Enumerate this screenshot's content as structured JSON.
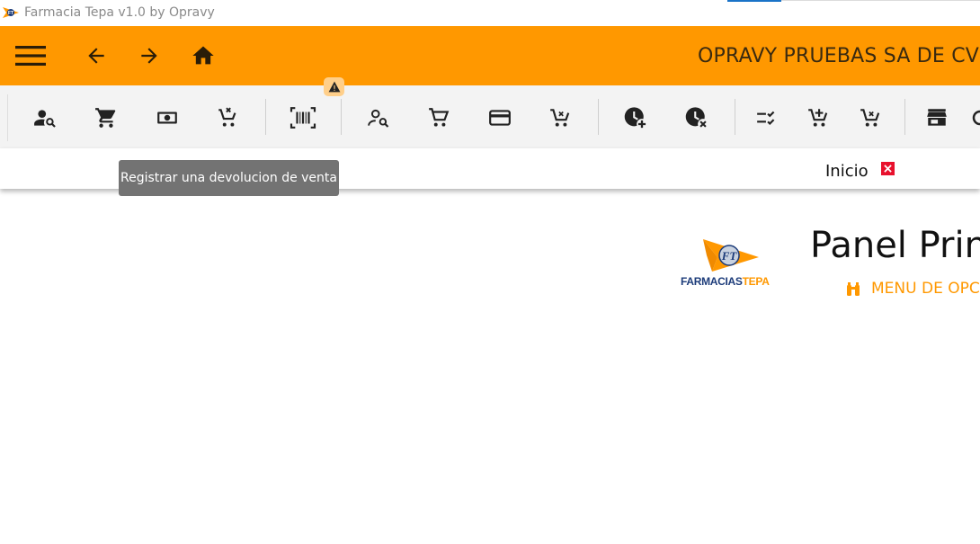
{
  "window": {
    "title": "Farmacia Tepa v1.0 by Opravy",
    "app_icon": "pharmacy-logo-icon"
  },
  "header": {
    "company": "OPRAVY PRUEBAS SA DE CV [pr",
    "background": "#ff9800",
    "buttons": [
      {
        "name": "menu-button",
        "icon": "hamburger-icon"
      },
      {
        "name": "back-button",
        "icon": "arrow-left-icon"
      },
      {
        "name": "forward-button",
        "icon": "arrow-right-icon"
      },
      {
        "name": "home-button",
        "icon": "home-icon"
      }
    ]
  },
  "toolbar": {
    "background": "#f3f3f3",
    "buttons": [
      {
        "name": "search-customer",
        "icon": "user-search-icon"
      },
      {
        "name": "sale-cart",
        "icon": "cart-icon"
      },
      {
        "name": "cash",
        "icon": "cash-icon"
      },
      {
        "name": "cancel-sale",
        "icon": "cart-remove-icon"
      },
      {
        "name": "barcode",
        "icon": "barcode-scan-icon"
      },
      {
        "name": "search-user",
        "icon": "user-search-outline-icon"
      },
      {
        "name": "cart-outline",
        "icon": "cart-outline-icon"
      },
      {
        "name": "card-payment",
        "icon": "credit-card-icon"
      },
      {
        "name": "cart-return",
        "icon": "cart-remove-outline-icon"
      },
      {
        "name": "clock-add",
        "icon": "clock-plus-icon"
      },
      {
        "name": "clock-remove",
        "icon": "clock-remove-icon"
      },
      {
        "name": "checklist",
        "icon": "list-check-icon"
      },
      {
        "name": "cart-add",
        "icon": "cart-plus-icon"
      },
      {
        "name": "cart-remove-2",
        "icon": "cart-minus-icon"
      },
      {
        "name": "store",
        "icon": "store-icon"
      },
      {
        "name": "more",
        "icon": "partial-icon"
      }
    ],
    "warning_badge_icon": "warning-icon"
  },
  "tooltip": {
    "text": "Registrar una devolucion de venta"
  },
  "tabs": [
    {
      "label": "Inicio",
      "close_icon": "close-icon",
      "close_color": "#e8112d"
    }
  ],
  "main": {
    "logo_text_part1": "FARMACIAS",
    "logo_text_part2": "TEPA",
    "title": "Panel Princ",
    "menu_link": "MENU DE OPCI",
    "menu_icon": "binoculars-icon",
    "accent": "#ff9800"
  }
}
